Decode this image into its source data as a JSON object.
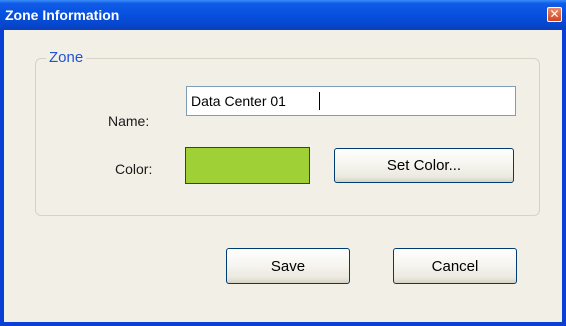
{
  "window": {
    "title": "Zone Information",
    "close_glyph": "✕"
  },
  "group": {
    "legend": "Zone"
  },
  "name": {
    "label": "Name:",
    "value": "Data Center 01"
  },
  "color": {
    "label": "Color:",
    "swatch_color": "#9fd136",
    "set_color_label": "Set Color..."
  },
  "buttons": {
    "save_label": "Save",
    "cancel_label": "Cancel"
  },
  "theme": {
    "titlebar_color": "#0850df",
    "legend_color": "#1f54d1"
  }
}
